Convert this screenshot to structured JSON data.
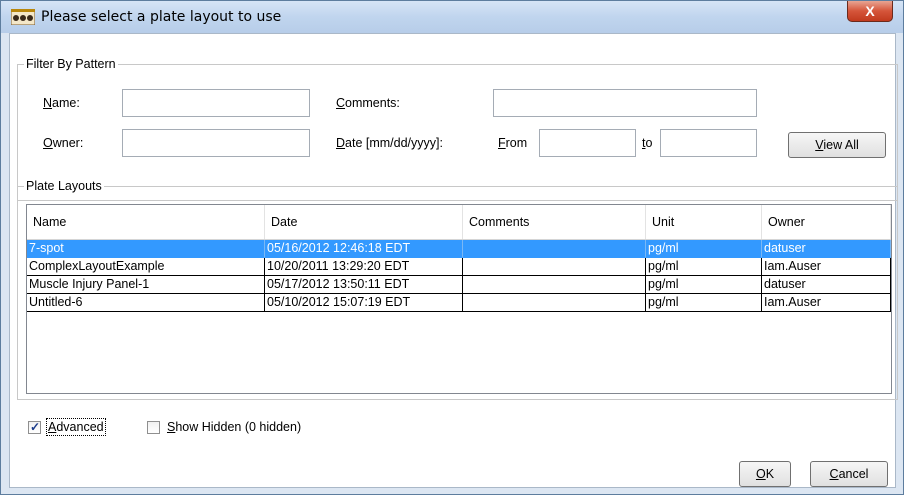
{
  "window": {
    "title": "Please select a plate layout to use",
    "close_glyph": "X",
    "icon": "plate-app-icon"
  },
  "filter": {
    "group_title": "Filter By Pattern",
    "name_label": "Name:",
    "name_label_mnemonic": "N",
    "name_label_rest": "ame:",
    "name_value": "",
    "comments_label_mnemonic": "C",
    "comments_label_rest": "omments:",
    "comments_value": "",
    "owner_label_mnemonic": "O",
    "owner_label_rest": "wner:",
    "owner_value": "",
    "date_label_mnemonic": "D",
    "date_label_rest": "ate [mm/dd/yyyy]:",
    "from_label_mnemonic": "F",
    "from_label_rest": "rom",
    "from_value": "",
    "to_label_mnemonic": "t",
    "to_label_rest": "o",
    "to_value": "",
    "view_all_mnemonic": "V",
    "view_all_rest": "iew All"
  },
  "layouts": {
    "group_title": "Plate Layouts",
    "columns": [
      "Name",
      "Date",
      "Comments",
      "Unit",
      "Owner"
    ],
    "rows": [
      {
        "name": "7-spot",
        "date": "05/16/2012 12:46:18 EDT",
        "comments": "",
        "unit": "pg/ml",
        "owner": "datuser",
        "selected": true
      },
      {
        "name": "ComplexLayoutExample",
        "date": "10/20/2011 13:29:20 EDT",
        "comments": "",
        "unit": "pg/ml",
        "owner": "Iam.Auser",
        "selected": false
      },
      {
        "name": "Muscle Injury Panel-1",
        "date": "05/17/2012 13:50:11 EDT",
        "comments": "",
        "unit": "pg/ml",
        "owner": "datuser",
        "selected": false
      },
      {
        "name": "Untitled-6",
        "date": "05/10/2012 15:07:19 EDT",
        "comments": "",
        "unit": "pg/ml",
        "owner": "Iam.Auser",
        "selected": false
      }
    ]
  },
  "options": {
    "advanced_mnemonic": "A",
    "advanced_rest": "dvanced",
    "advanced_checked": true,
    "show_hidden_mnemonic": "S",
    "show_hidden_rest": "how Hidden (0 hidden)",
    "show_hidden_checked": false
  },
  "buttons": {
    "ok_mnemonic": "O",
    "ok_rest": "K",
    "cancel_mnemonic": "C",
    "cancel_rest": "ancel"
  },
  "colors": {
    "selection": "#3399ff",
    "close": "#c13a1e"
  }
}
